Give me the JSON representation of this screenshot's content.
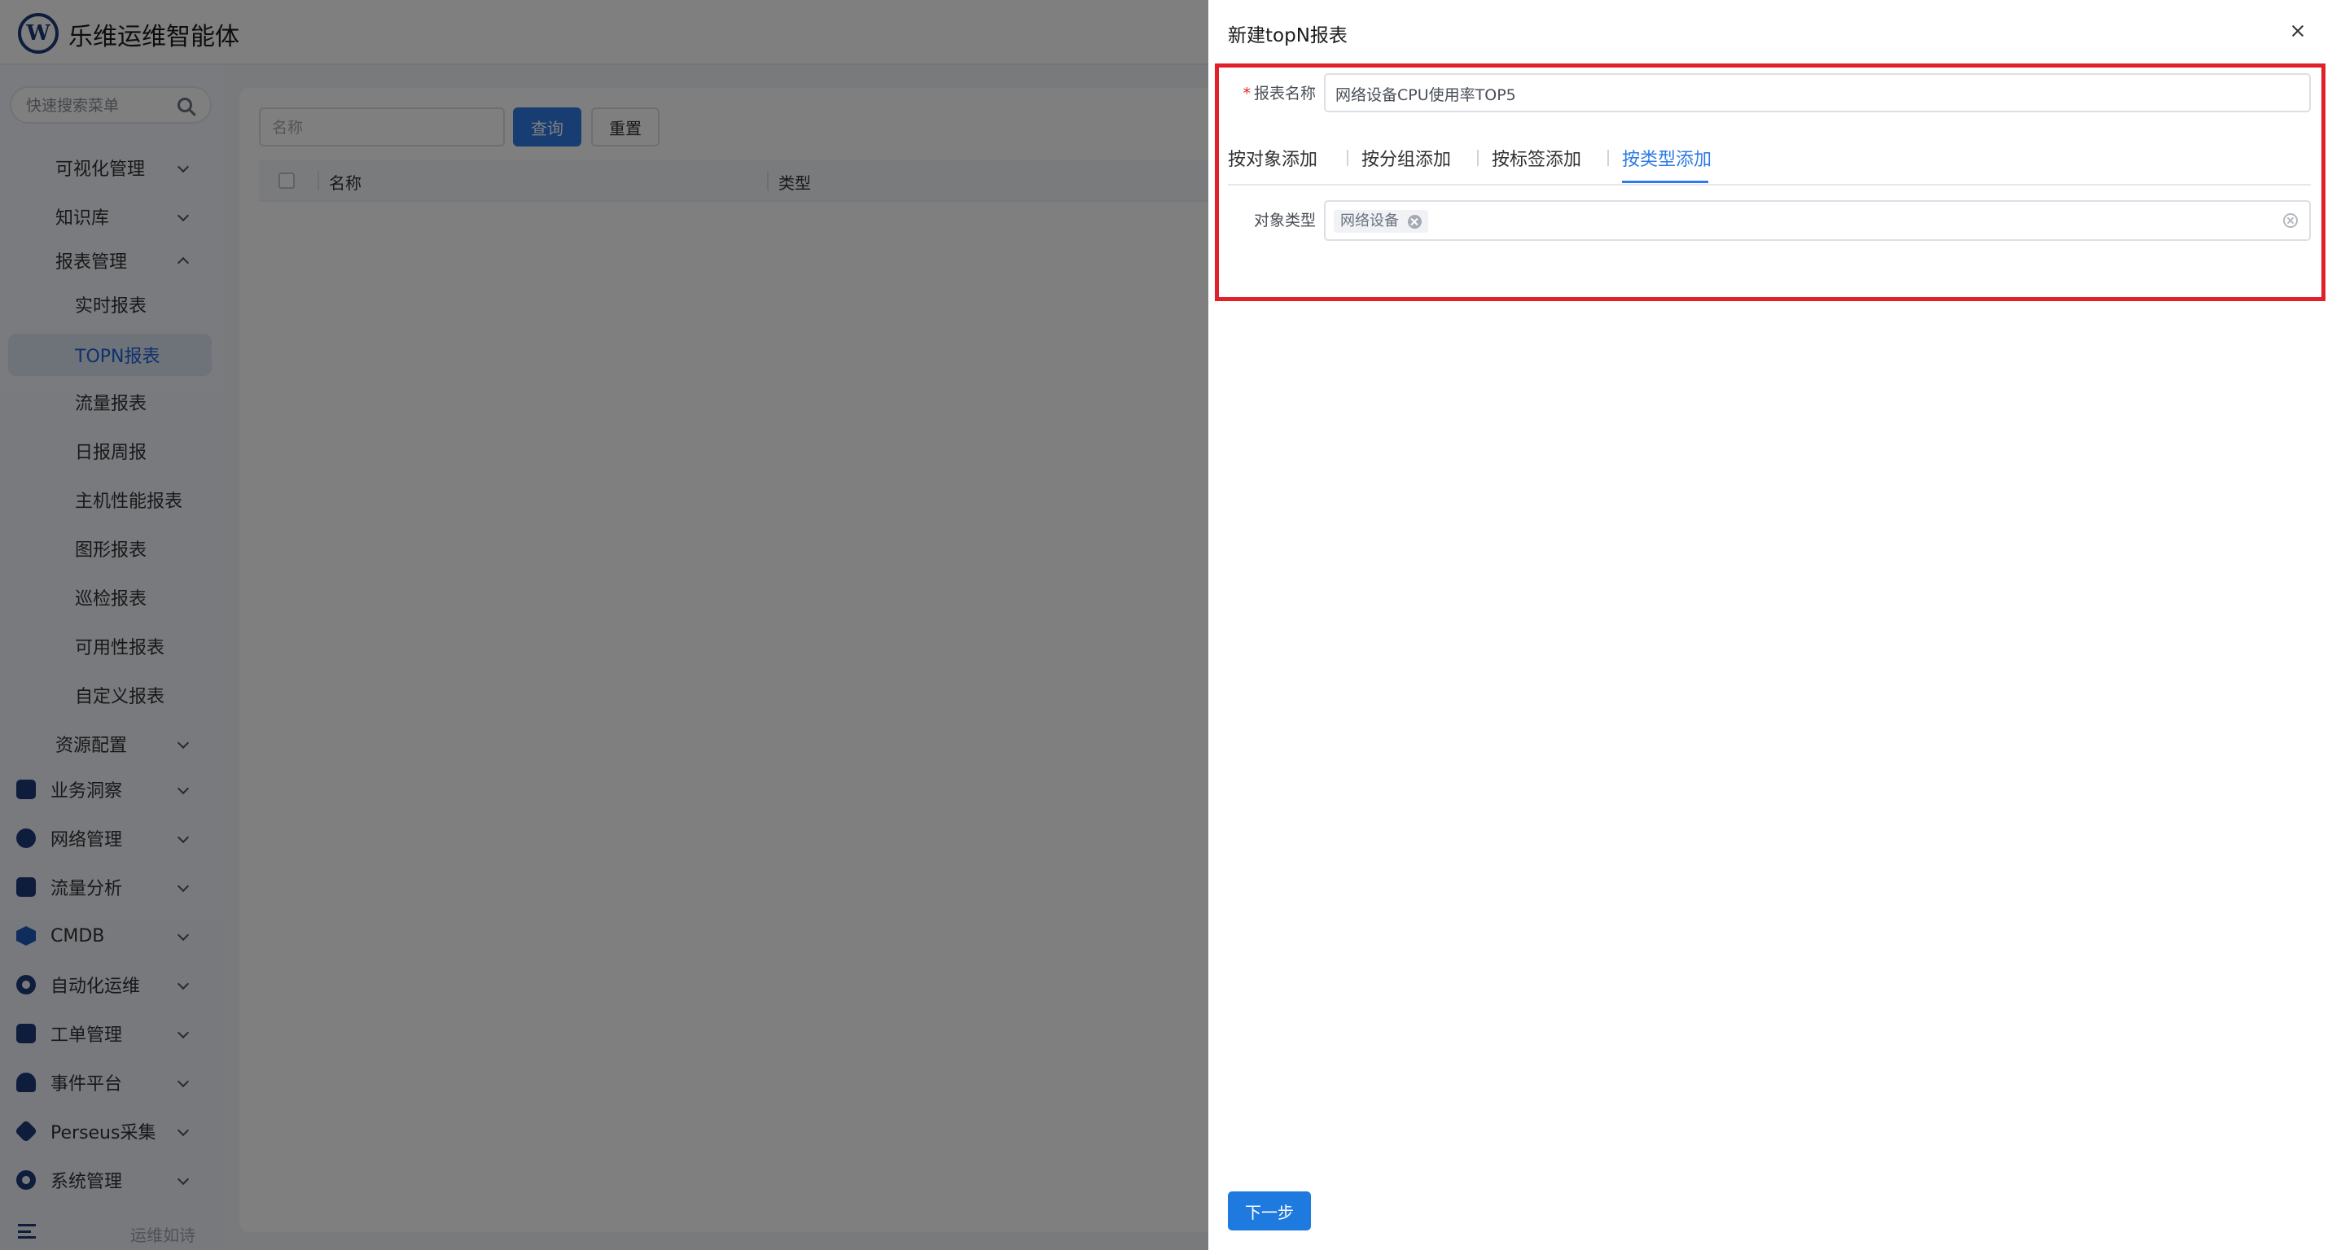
{
  "app": {
    "title": "乐维运维智能体",
    "logo_letter": "W"
  },
  "sidebar": {
    "search_placeholder": "快速搜索菜单",
    "items": [
      {
        "label": "可视化管理",
        "expanded": false
      },
      {
        "label": "知识库",
        "expanded": false
      },
      {
        "label": "报表管理",
        "expanded": true
      },
      {
        "label": "实时报表"
      },
      {
        "label": "TOPN报表",
        "active": true
      },
      {
        "label": "流量报表"
      },
      {
        "label": "日报周报"
      },
      {
        "label": "主机性能报表"
      },
      {
        "label": "图形报表"
      },
      {
        "label": "巡检报表"
      },
      {
        "label": "可用性报表"
      },
      {
        "label": "自定义报表"
      },
      {
        "label": "资源配置",
        "expanded": false
      },
      {
        "label": "业务洞察",
        "icon": "monitor-icon"
      },
      {
        "label": "网络管理",
        "icon": "globe-icon"
      },
      {
        "label": "流量分析",
        "icon": "chart-icon"
      },
      {
        "label": "CMDB",
        "icon": "cube-icon"
      },
      {
        "label": "自动化运维",
        "icon": "gear-icon"
      },
      {
        "label": "工单管理",
        "icon": "calendar-icon"
      },
      {
        "label": "事件平台",
        "icon": "bell-icon"
      },
      {
        "label": "Perseus采集",
        "icon": "diamond-icon"
      },
      {
        "label": "系统管理",
        "icon": "settings-icon"
      }
    ],
    "bottom_hint": "运维如诗"
  },
  "main": {
    "name_placeholder": "名称",
    "query_label": "查询",
    "reset_label": "重置",
    "columns": [
      "名称",
      "类型"
    ]
  },
  "drawer": {
    "title": "新建topN报表",
    "report_name_label": "报表名称",
    "report_name_value": "网络设备CPU使用率TOP5",
    "tabs": [
      {
        "label": "按对象添加"
      },
      {
        "label": "按分组添加"
      },
      {
        "label": "按标签添加"
      },
      {
        "label": "按类型添加",
        "active": true
      }
    ],
    "object_type_label": "对象类型",
    "selected_types": [
      "网络设备"
    ],
    "next_label": "下一步"
  },
  "colors": {
    "primary": "#2f7be6",
    "highlight": "#e0202a",
    "brand": "#1f3b78"
  }
}
